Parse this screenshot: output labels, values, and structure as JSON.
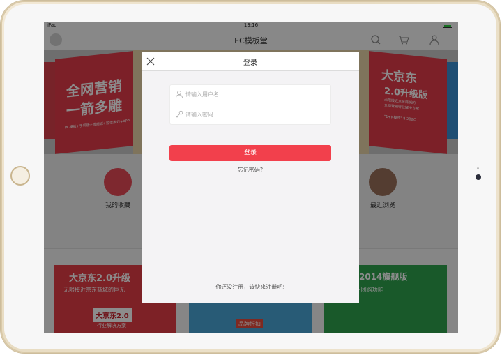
{
  "status_bar": {
    "device": "iPad",
    "time": "13:16"
  },
  "nav_bar": {
    "title": "EC模板堂"
  },
  "background": {
    "banner_left": {
      "line1": "全网营销",
      "line2": "一箭多雕",
      "caption": "PC模板+手机版+微商城+短信轰炸+APP"
    },
    "banner_right": {
      "line1": "大京东",
      "line2": "2.0升级版",
      "line3": "无限接近京东商城的",
      "line4": "全网营销行业解决方案",
      "line5": "\"1+N模式\" 8 2B2C"
    },
    "categories": [
      {
        "label": "我的收藏",
        "icon": "star-icon",
        "color": "#e64a56"
      },
      {
        "label": "最近浏览",
        "icon": "clock-icon",
        "color": "#9a6f5a"
      }
    ],
    "promos": [
      {
        "title": "大京东2.0升级",
        "subtitle": "无限接近京东商城的巨无"
      },
      {
        "title": "新京东2014旗舰版",
        "subtitle": "全网最强+团购功能"
      }
    ],
    "promo_extra": "大京东2.0",
    "promo_extra_sub": "行业解决方案",
    "promo_mid_label": "品牌折扣"
  },
  "modal": {
    "title": "登录",
    "username": {
      "placeholder": "请输入用户名",
      "value": ""
    },
    "password": {
      "placeholder": "请输入密码",
      "value": ""
    },
    "login_button": "登录",
    "forgot_link": "忘记密码?",
    "register_text": "你还没注册，该快来注册吧!"
  },
  "colors": {
    "accent": "#f2404c",
    "modal_bg": "#f4f3f5",
    "device_frame": "#ece2cc"
  }
}
